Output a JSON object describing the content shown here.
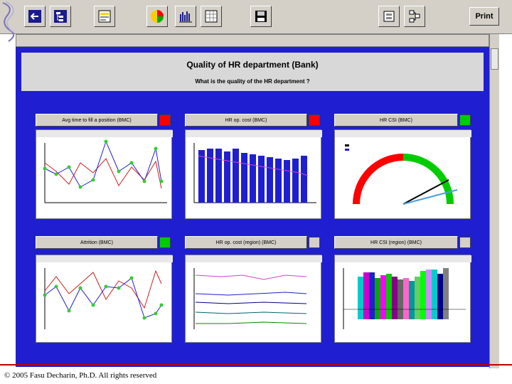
{
  "toolbar": {
    "buttons": [
      "back-arrow-icon",
      "tree-icon",
      "report-icon",
      "pie-chart-icon",
      "bar-chart-icon",
      "table-icon",
      "save-icon",
      "copy-icon",
      "network-icon"
    ],
    "print_label": "Print"
  },
  "header": {
    "title": "Quality of HR department (Bank)",
    "subtitle": "What is the quality of the HR department ?"
  },
  "panels": [
    {
      "label": "Avg time to fill a position (BMC)",
      "status_color": "#ff0000"
    },
    {
      "label": "HR op. cost (BMC)",
      "status_color": "#ff0000"
    },
    {
      "label": "HR CSI (BMC)",
      "status_color": "#00cc00"
    },
    {
      "label": "Attrition (BMC)",
      "status_color": "#00cc00"
    },
    {
      "label": "HR op. cost (region) (BMC)",
      "status_color": "#d4d0c8"
    },
    {
      "label": "HR CSI (region) (BMC)",
      "status_color": "#d4d0c8"
    }
  ],
  "colors": {
    "dashboard_bg": "#1f1fd1",
    "bar_blue": "#1f1fd1",
    "line_red": "#cc2020",
    "marker_green": "#33cc33",
    "gauge_red": "#ff0000",
    "gauge_green": "#00cc00"
  },
  "footer": {
    "copyright": "© 2005 Fasu Decharin, Ph.D. All rights reserved"
  }
}
